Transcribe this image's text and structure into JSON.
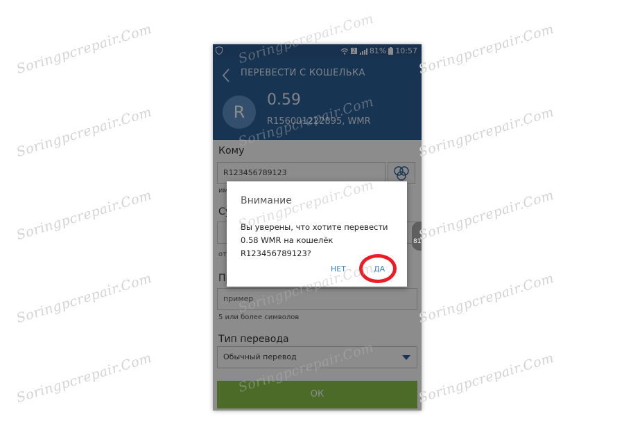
{
  "watermark": "Soringpcrepair.Com",
  "status_bar": {
    "battery_percent": "81%",
    "time": "10:57",
    "sim_badge": "2"
  },
  "header": {
    "title": "ПЕРЕВЕСТИ С КОШЕЛЬКА",
    "avatar_letter": "R",
    "amount": "0.59",
    "purse": "R156001222895, WMR"
  },
  "form": {
    "to_label": "Кому",
    "to_value": "R123456789123",
    "to_hint": "им",
    "amount_label": "Су",
    "amount_hint": "от",
    "note_label": "Пр",
    "note_placeholder": "пример",
    "note_hint": "5 или более символов",
    "type_label": "Тип перевода",
    "type_value": "Обычный перевод",
    "ok_label": "ОК",
    "side_badge": "81"
  },
  "dialog": {
    "title": "Внимание",
    "message": "Вы уверены, что хотите перевести 0.58 WMR на кошелёк R123456789123?",
    "no_label": "НЕТ",
    "yes_label": "ДА"
  },
  "colors": {
    "header": "#2a5f96",
    "ok_button": "#8bc34a",
    "dialog_button_text": "#3f7fc2",
    "highlight_ring": "#ec1c24"
  }
}
